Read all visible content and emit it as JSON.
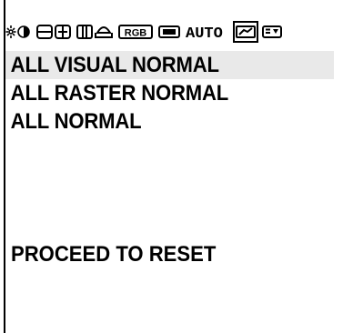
{
  "tabs": [
    {
      "name": "brightness-contrast-icon",
      "selected": false
    },
    {
      "name": "size-position-icon",
      "selected": false
    },
    {
      "name": "geometry-icon",
      "selected": false
    },
    {
      "name": "rgb-label",
      "label": "RGB",
      "selected": false
    },
    {
      "name": "screen-icon",
      "selected": false
    },
    {
      "name": "auto-label",
      "label": "AUTO",
      "selected": false
    },
    {
      "name": "reset-icon",
      "selected": true
    },
    {
      "name": "menu-icon",
      "selected": false
    }
  ],
  "menu": {
    "items": [
      {
        "label": "ALL VISUAL NORMAL",
        "highlighted": true
      },
      {
        "label": "ALL RASTER NORMAL",
        "highlighted": false
      },
      {
        "label": "ALL NORMAL",
        "highlighted": false
      }
    ],
    "proceed_label": "PROCEED TO RESET"
  },
  "colors": {
    "highlight": "#e9e9e9",
    "text": "#000000",
    "background": "#ffffff"
  }
}
